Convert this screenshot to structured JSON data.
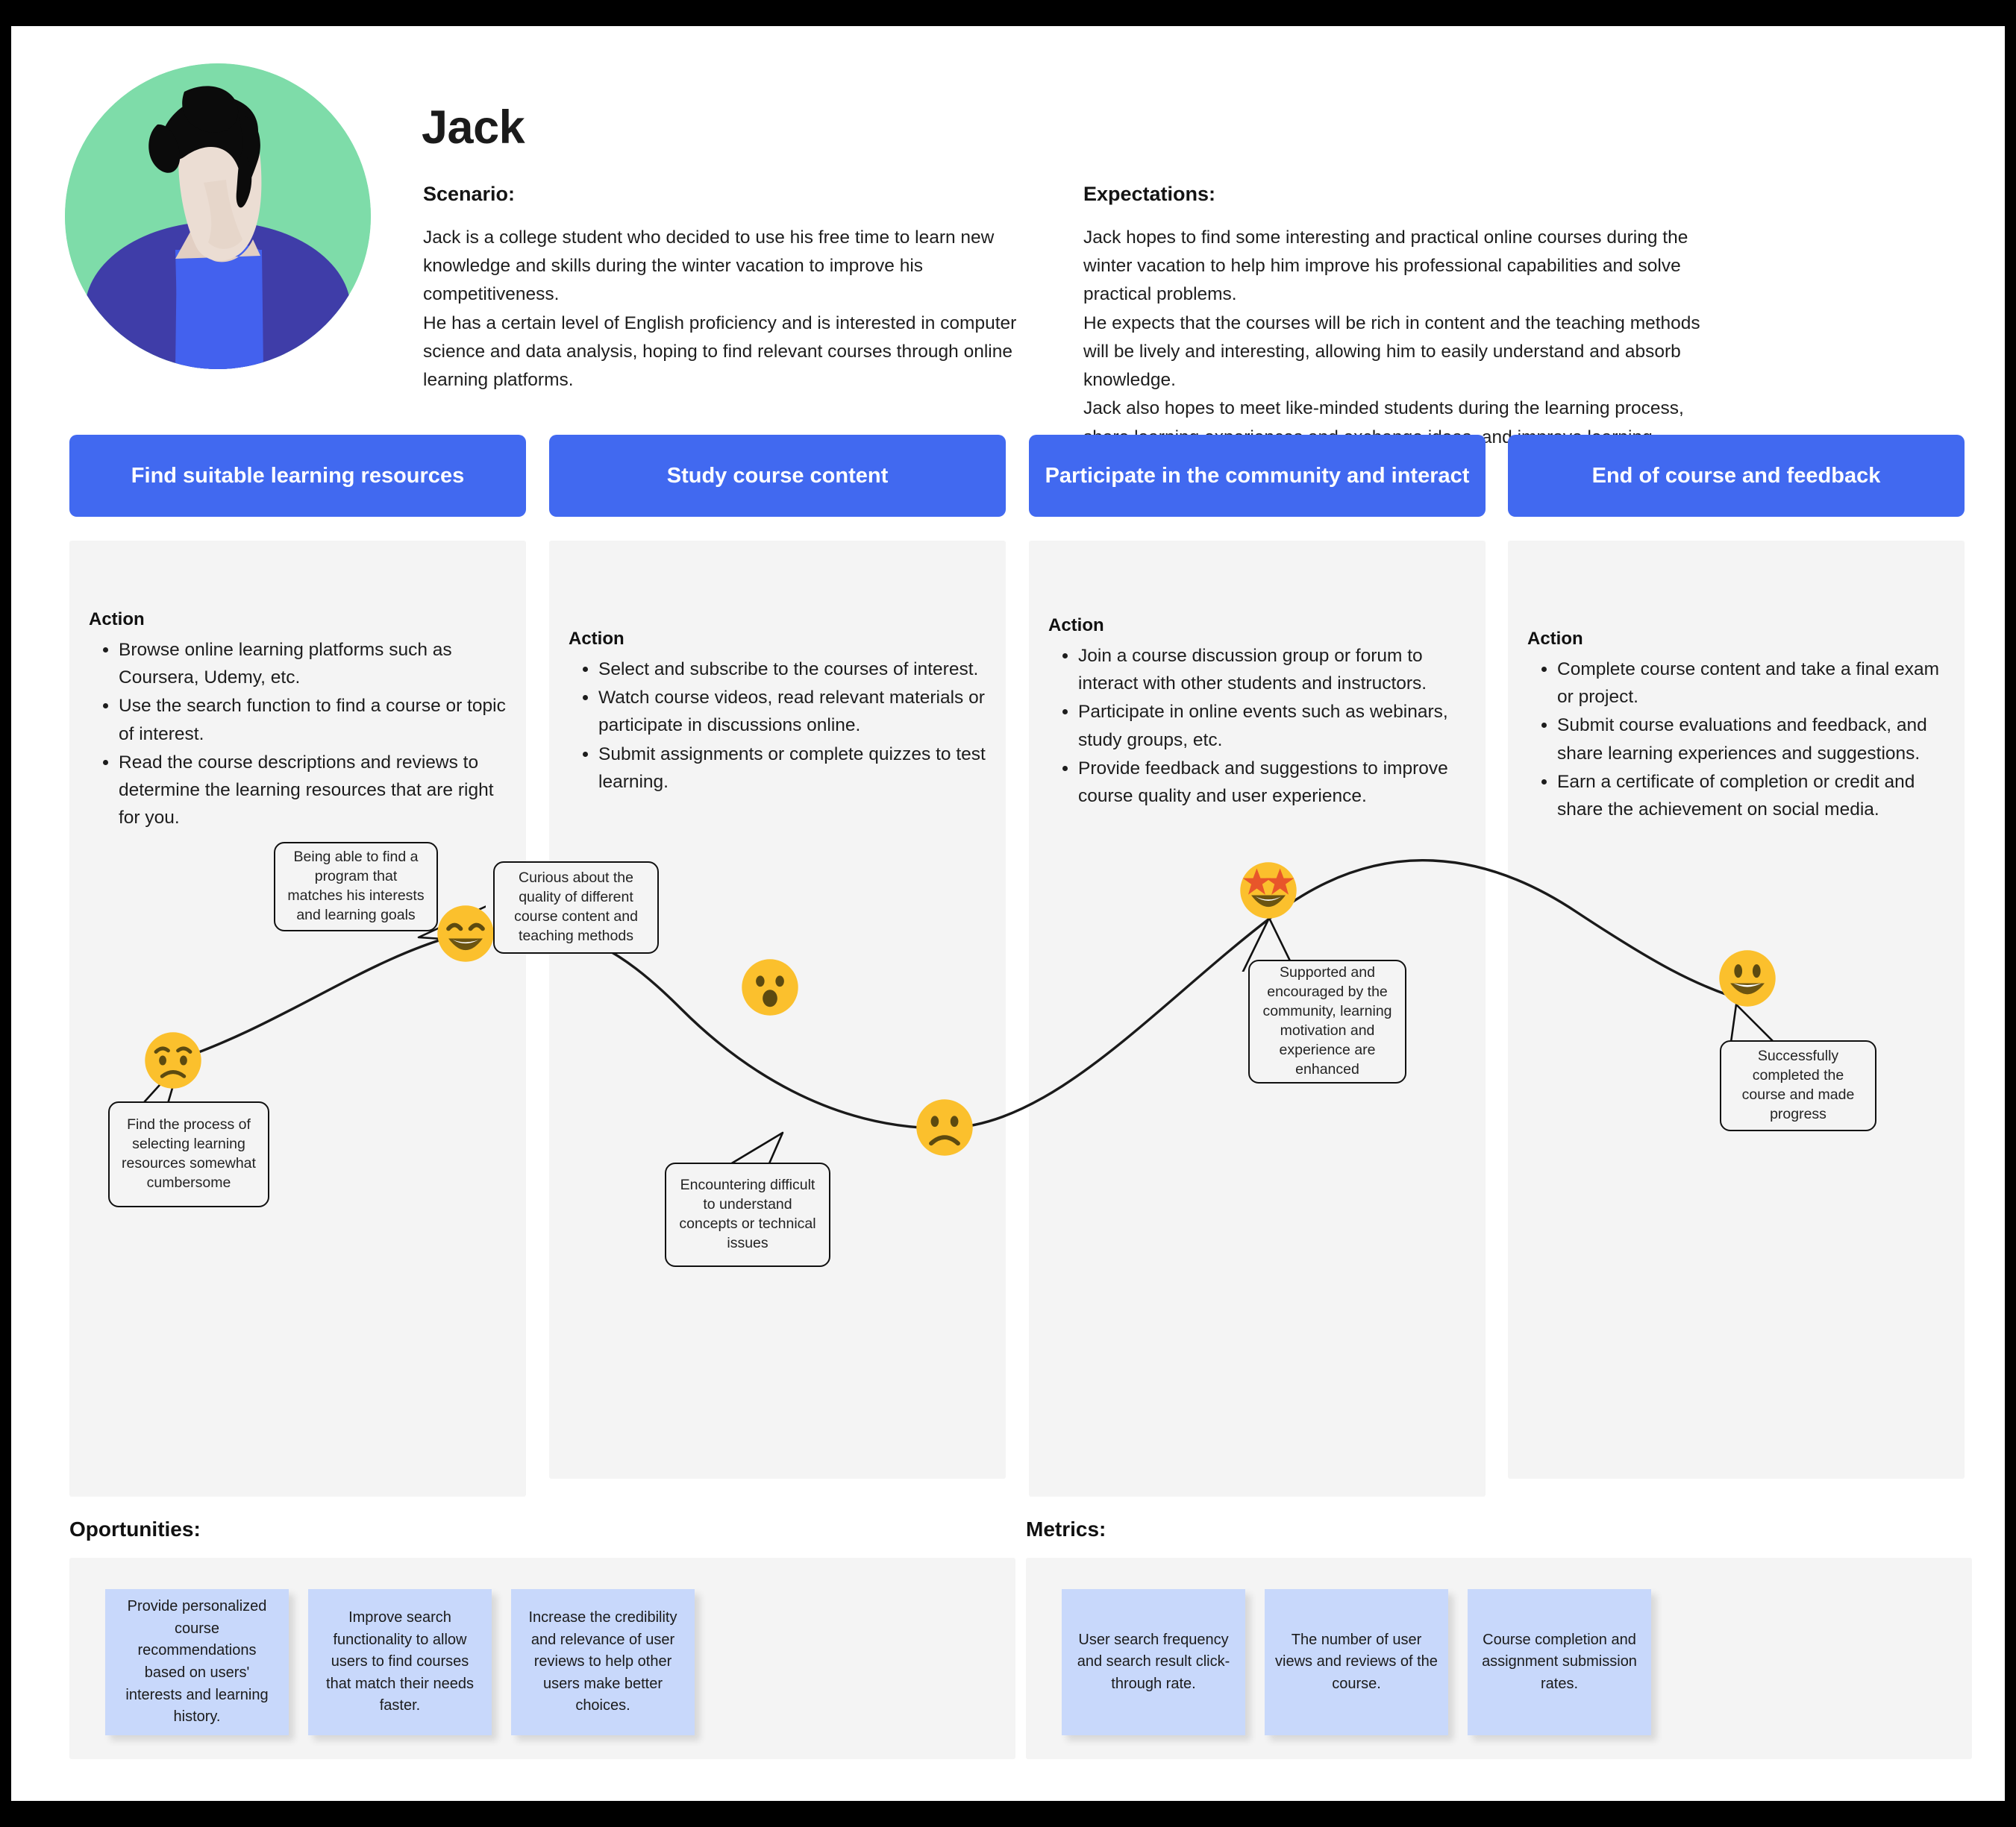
{
  "persona": {
    "name": "Jack",
    "avatar_icon": "person-avatar-icon",
    "scenario_title": "Scenario:",
    "scenario_body": "Jack is a college student who decided to use his free time to learn new knowledge and skills during the winter vacation to improve his competitiveness.\nHe has a certain level of English proficiency and is interested in computer science and data analysis, hoping to find relevant courses through online learning platforms.",
    "expectations_title": "Expectations:",
    "expectations_body": "Jack hopes to find some interesting and practical online courses during the winter vacation to help him improve his professional capabilities and solve practical problems.\nHe expects that the courses will be rich in content and the teaching methods will be lively and interesting, allowing him to easily understand and absorb knowledge.\nJack also hopes to meet like-minded students during the learning process, share learning experiences and exchange ideas, and improve learning efficiency and enthusiasm."
  },
  "colors": {
    "stage_header": "#4169f0",
    "panel_bg": "#f4f4f4",
    "note_bg": "#c8d8fb",
    "avatar_bg": "#7edca9",
    "emoji_yellow": "#fbc02d",
    "star_orange": "#e8562a"
  },
  "stages": [
    {
      "header": "Find suitable learning resources",
      "action_title": "Action",
      "actions": [
        "Browse online learning platforms such as Coursera, Udemy, etc.",
        "Use the search function to find a course or topic of interest.",
        "Read the course descriptions and reviews to determine the learning resources that are right for you."
      ]
    },
    {
      "header": "Study course content",
      "action_title": "Action",
      "actions": [
        "Select and subscribe to the courses of interest.",
        "Watch course videos, read relevant materials or participate in discussions online.",
        "Submit assignments or complete quizzes to test learning."
      ]
    },
    {
      "header": "Participate in the community and interact",
      "action_title": "Action",
      "actions": [
        "Join a course discussion group or forum to interact with other students and instructors.",
        "Participate in online events such as webinars, study groups, etc.",
        "Provide feedback and suggestions to improve course quality and user experience."
      ]
    },
    {
      "header": "End of course and feedback",
      "action_title": "Action",
      "actions": [
        "Complete course content and take a final exam or project.",
        "Submit course evaluations and feedback, and share learning experiences and suggestions.",
        "Earn a certificate of completion or credit and share the achievement on social media."
      ]
    }
  ],
  "emotion_points": [
    {
      "icon": "worried-face-icon",
      "mood": "worried",
      "stage": 1,
      "bubble": "Find the process of selecting learning resources somewhat cumbersome"
    },
    {
      "icon": "grinning-squinting-face-icon",
      "mood": "happy",
      "stage": 1,
      "bubble": "Being able to find a program that matches his interests and learning goals"
    },
    {
      "icon": "surprised-face-icon",
      "mood": "curious",
      "stage": 2,
      "bubble": "Curious about the quality of different course content and teaching methods"
    },
    {
      "icon": "frowning-face-icon",
      "mood": "frustrated",
      "stage": 2,
      "bubble": "Encountering difficult to understand concepts or technical issues"
    },
    {
      "icon": "star-struck-face-icon",
      "mood": "delighted",
      "stage": 3,
      "bubble": "Supported and encouraged by the community, learning motivation and experience are enhanced"
    },
    {
      "icon": "grinning-face-icon",
      "mood": "satisfied",
      "stage": 4,
      "bubble": "Successfully completed the course and made progress"
    }
  ],
  "opportunities": {
    "title": "Oportunities:",
    "notes": [
      "Provide personalized course recommendations based on users' interests and learning history.",
      "Improve search functionality to allow users to find courses that match their needs faster.",
      "Increase the credibility and relevance of user reviews to help other users make better choices."
    ]
  },
  "metrics": {
    "title": "Metrics:",
    "notes": [
      "User search frequency and search result click-through rate.",
      "The number of user views and reviews of the course.",
      "Course completion and assignment submission rates."
    ]
  }
}
